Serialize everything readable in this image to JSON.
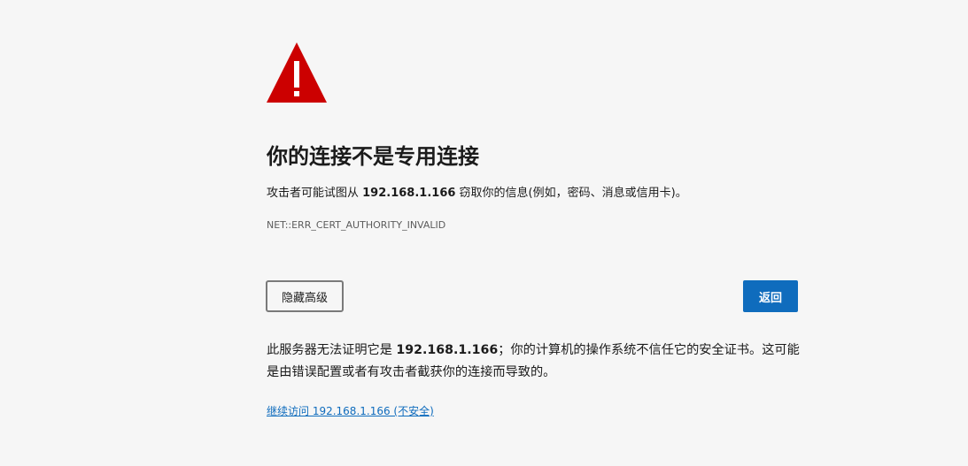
{
  "heading": "你的连接不是专用连接",
  "summary": {
    "prefix": "攻击者可能试图从 ",
    "host": "192.168.1.166",
    "suffix": " 窃取你的信息(例如，密码、消息或信用卡)。"
  },
  "error_code": "NET::ERR_CERT_AUTHORITY_INVALID",
  "buttons": {
    "advanced_label": "隐藏高级",
    "back_label": "返回"
  },
  "details": {
    "prefix": "此服务器无法证明它是 ",
    "host": "192.168.1.166",
    "suffix": "；你的计算机的操作系统不信任它的安全证书。这可能是由错误配置或者有攻击者截获你的连接而导致的。"
  },
  "proceed_link": "继续访问 192.168.1.166 (不安全)",
  "icon": "warning-triangle-icon",
  "colors": {
    "background": "#f6f6f6",
    "warning_red": "#cc0000",
    "accent_blue": "#0f6cbd"
  }
}
